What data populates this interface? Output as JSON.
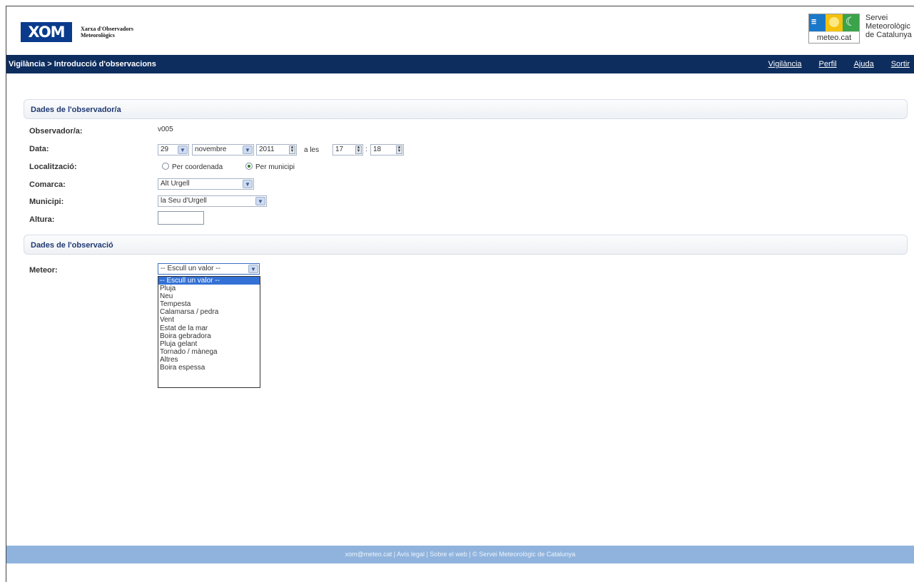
{
  "header": {
    "xom_logo": "XOM",
    "xom_subtitle_line1": "Xarxa d'Observadors",
    "xom_subtitle_line2": "Meteorològics",
    "smc_domain": "meteo.cat",
    "smc_name": "Servei\nMeteorològic\nde Catalunya"
  },
  "nav": {
    "breadcrumb": "Vigilància > Introducció d'observacions",
    "links": [
      "Vigilància",
      "Perfil",
      "Ajuda",
      "Sortir"
    ]
  },
  "observer_section": {
    "title": "Dades de l'observador/a",
    "labels": {
      "observer": "Observador/a:",
      "date": "Data:",
      "location": "Localització:",
      "comarca": "Comarca:",
      "municipi": "Municipi:",
      "altura": "Altura:"
    },
    "observer_value": "v005",
    "date": {
      "day": "29",
      "month": "novembre",
      "year": "2011",
      "at": "a les",
      "hour": "17",
      "minute": "18"
    },
    "location_options": [
      "Per coordenada",
      "Per municipi"
    ],
    "location_selected": "Per municipi",
    "comarca_value": "Alt Urgell",
    "municipi_value": "la Seu d'Urgell",
    "altura_value": ""
  },
  "observation_section": {
    "title": "Dades de l'observació",
    "meteor_label": "Meteor:",
    "meteor_selected": "-- Escull un valor --",
    "meteor_options": [
      "-- Escull un valor --",
      "Pluja",
      "Neu",
      "Tempesta",
      "Calamarsa / pedra",
      "Vent",
      "Estat de la mar",
      "Boira gebradora",
      "Pluja gelant",
      "Tornado / mànega",
      "Altres",
      "Boira espessa"
    ]
  },
  "footer": {
    "text": "xom@meteo.cat  |  Avís legal  |  Sobre el web  |  © Servei Meteorològic de Catalunya"
  }
}
